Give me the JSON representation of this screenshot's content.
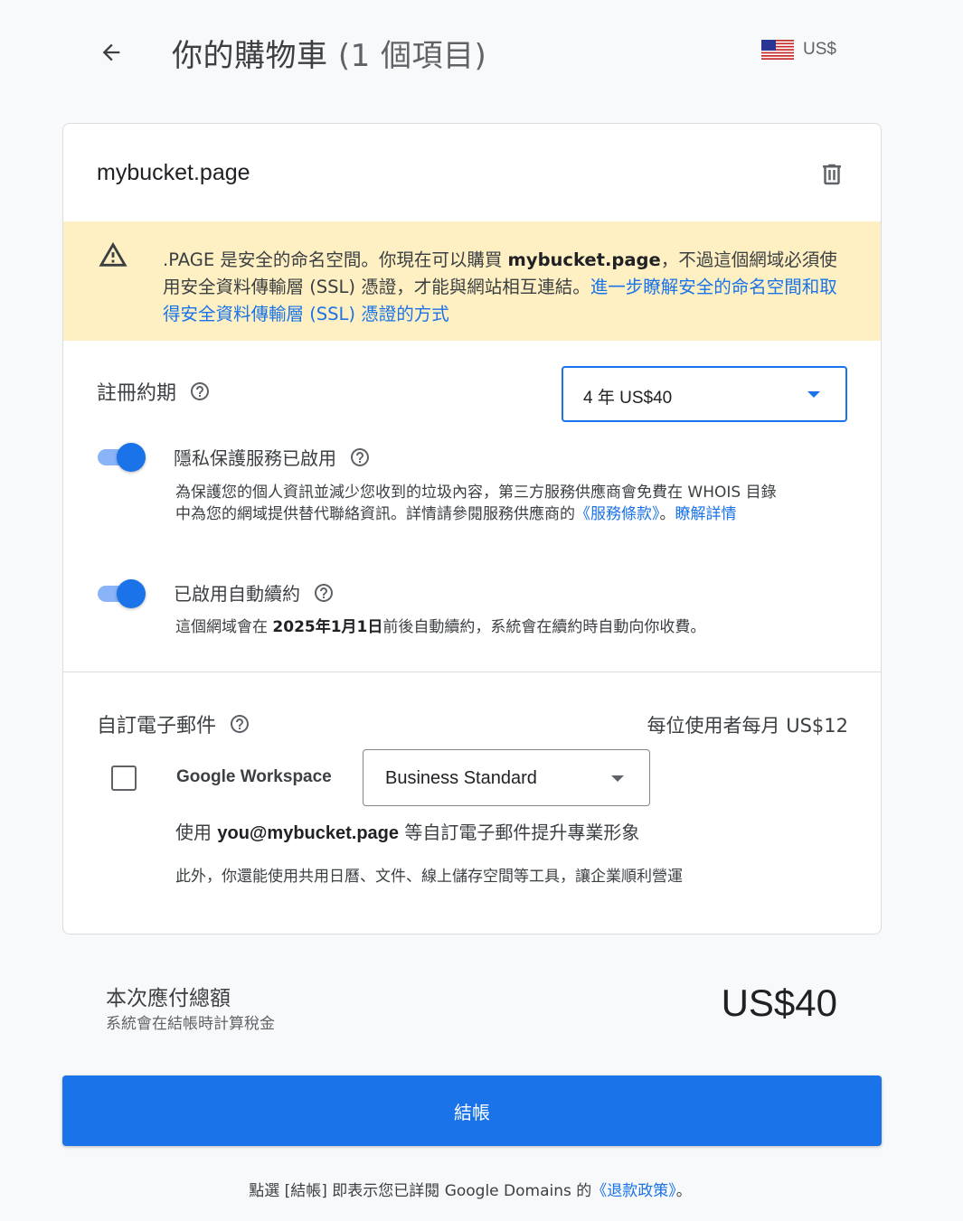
{
  "header": {
    "title": "你的購物車",
    "item_count": "(1 個項目)",
    "currency": "US$"
  },
  "cart": {
    "domain": "mybucket.page",
    "warning": {
      "text_before": ".PAGE 是安全的命名空間。你現在可以購買 ",
      "domain_bold": "mybucket.page",
      "text_after": "，不過這個網域必須使用安全資料傳輸層 (SSL) 憑證，才能與網站相互連結。",
      "link": "進一步瞭解安全的命名空間和取得安全資料傳輸層 (SSL) 憑證的方式"
    },
    "term": {
      "label": "註冊約期",
      "selected": "4 年 US$40"
    },
    "privacy": {
      "title": "隱私保護服務已啟用",
      "enabled": true,
      "desc_before": "為保護您的個人資訊並減少您收到的垃圾內容，第三方服務供應商會免費在 WHOIS 目錄中為您的網域提供替代聯絡資訊。詳情請參閱服務供應商的",
      "terms_link": "《服務條款》",
      "sep": "。",
      "learn_more": "瞭解詳情"
    },
    "autorenew": {
      "title": "已啟用自動續約",
      "enabled": true,
      "desc_before": "這個網域會在 ",
      "date": "2025年1月1日",
      "desc_after": "前後自動續約，系統會在續約時自動向你收費。"
    },
    "email": {
      "label": "自訂電子郵件",
      "price": "每位使用者每月 US$12",
      "product": "Google Workspace",
      "checked": false,
      "plan": "Business Standard",
      "desc1_before": "使用 ",
      "desc1_bold": "you@mybucket.page",
      "desc1_after": " 等自訂電子郵件提升專業形象",
      "desc2": "此外，你還能使用共用日曆、文件、線上儲存空間等工具，讓企業順利營運"
    }
  },
  "total": {
    "label": "本次應付總額",
    "sub": "系統會在結帳時計算稅金",
    "amount": "US$40"
  },
  "checkout_label": "結帳",
  "footer": {
    "before": "點選 [結帳] 即表示您已詳閱 Google Domains 的",
    "link": "《退款政策》",
    "after": "。"
  },
  "colors": {
    "accent": "#1a73e8",
    "warning_bg": "#fef0c3",
    "toggle_track": "#8ab4f8"
  }
}
